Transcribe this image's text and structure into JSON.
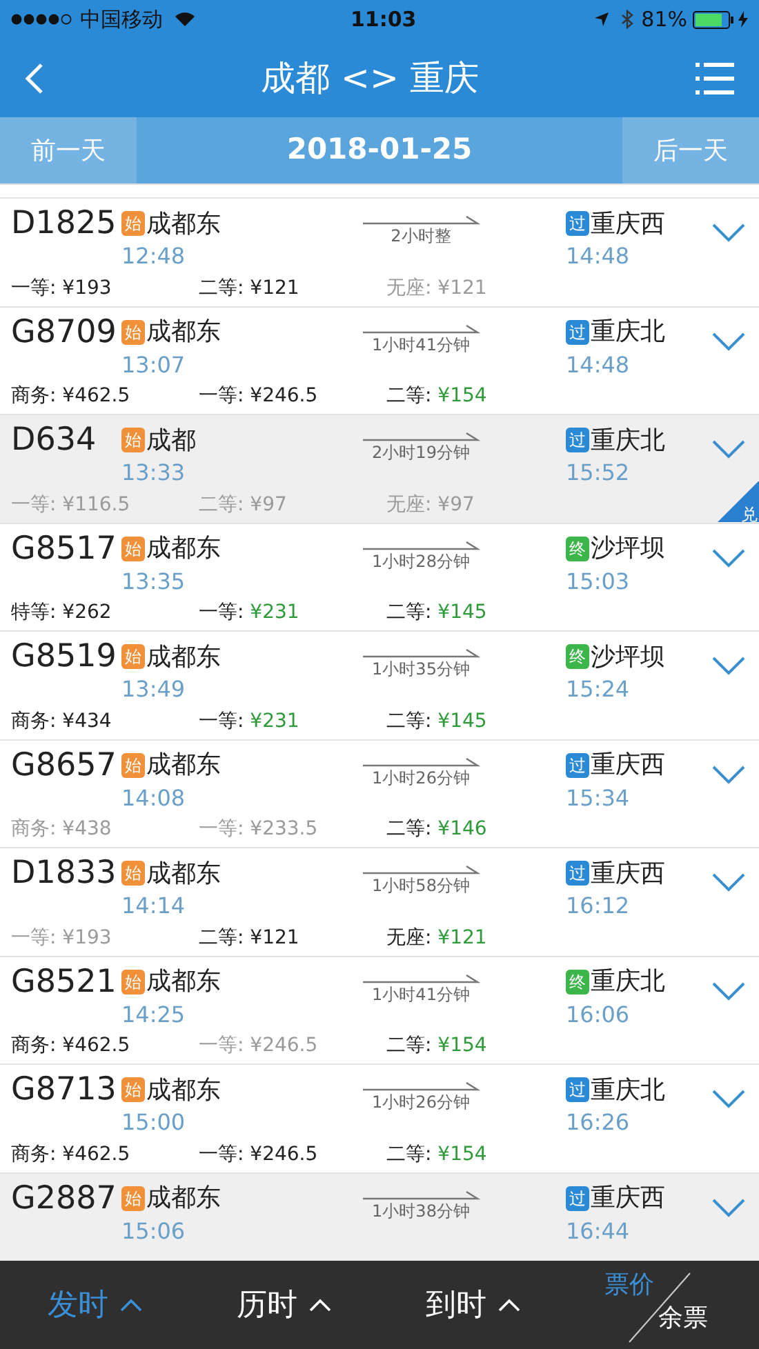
{
  "status_bar": {
    "carrier": "中国移动",
    "time": "11:03",
    "battery": "81%"
  },
  "header": {
    "title": "成都 <> 重庆"
  },
  "date_bar": {
    "prev": "前一天",
    "date": "2018-01-25",
    "next": "后一天"
  },
  "trains": [
    {
      "number": "D1825",
      "from_badge": {
        "kind": "start",
        "text": "始"
      },
      "from": "成都东",
      "depart": "12:48",
      "duration": "2小时整",
      "to_badge": {
        "kind": "pass",
        "text": "过"
      },
      "to": "重庆西",
      "arrive": "14:48",
      "shaded": false,
      "fares": [
        {
          "label": "一等:",
          "price": "¥193",
          "kind": "limited"
        },
        {
          "label": "二等:",
          "price": "¥121",
          "kind": "limited"
        },
        {
          "label": "无座:",
          "price": "¥121",
          "kind": "none"
        }
      ]
    },
    {
      "number": "G8709",
      "from_badge": {
        "kind": "start",
        "text": "始"
      },
      "from": "成都东",
      "depart": "13:07",
      "duration": "1小时41分钟",
      "to_badge": {
        "kind": "pass",
        "text": "过"
      },
      "to": "重庆北",
      "arrive": "14:48",
      "shaded": false,
      "fares": [
        {
          "label": "商务:",
          "price": "¥462.5",
          "kind": "limited"
        },
        {
          "label": "一等:",
          "price": "¥246.5",
          "kind": "limited"
        },
        {
          "label": "二等:",
          "price": "¥154",
          "kind": "plenty"
        }
      ]
    },
    {
      "number": "D634",
      "from_badge": {
        "kind": "start",
        "text": "始"
      },
      "from": "成都",
      "depart": "13:33",
      "duration": "2小时19分钟",
      "to_badge": {
        "kind": "pass",
        "text": "过"
      },
      "to": "重庆北",
      "arrive": "15:52",
      "shaded": true,
      "corner_badge": "兑",
      "fares": [
        {
          "label": "一等:",
          "price": "¥116.5",
          "kind": "none"
        },
        {
          "label": "二等:",
          "price": "¥97",
          "kind": "none"
        },
        {
          "label": "无座:",
          "price": "¥97",
          "kind": "none"
        }
      ]
    },
    {
      "number": "G8517",
      "from_badge": {
        "kind": "start",
        "text": "始"
      },
      "from": "成都东",
      "depart": "13:35",
      "duration": "1小时28分钟",
      "to_badge": {
        "kind": "end",
        "text": "终"
      },
      "to": "沙坪坝",
      "arrive": "15:03",
      "shaded": false,
      "fares": [
        {
          "label": "特等:",
          "price": "¥262",
          "kind": "limited"
        },
        {
          "label": "一等:",
          "price": "¥231",
          "kind": "plenty"
        },
        {
          "label": "二等:",
          "price": "¥145",
          "kind": "plenty"
        }
      ]
    },
    {
      "number": "G8519",
      "from_badge": {
        "kind": "start",
        "text": "始"
      },
      "from": "成都东",
      "depart": "13:49",
      "duration": "1小时35分钟",
      "to_badge": {
        "kind": "end",
        "text": "终"
      },
      "to": "沙坪坝",
      "arrive": "15:24",
      "shaded": false,
      "fares": [
        {
          "label": "商务:",
          "price": "¥434",
          "kind": "limited"
        },
        {
          "label": "一等:",
          "price": "¥231",
          "kind": "plenty"
        },
        {
          "label": "二等:",
          "price": "¥145",
          "kind": "plenty"
        }
      ]
    },
    {
      "number": "G8657",
      "from_badge": {
        "kind": "start",
        "text": "始"
      },
      "from": "成都东",
      "depart": "14:08",
      "duration": "1小时26分钟",
      "to_badge": {
        "kind": "pass",
        "text": "过"
      },
      "to": "重庆西",
      "arrive": "15:34",
      "shaded": false,
      "fares": [
        {
          "label": "商务:",
          "price": "¥438",
          "kind": "none"
        },
        {
          "label": "一等:",
          "price": "¥233.5",
          "kind": "none"
        },
        {
          "label": "二等:",
          "price": "¥146",
          "kind": "plenty"
        }
      ]
    },
    {
      "number": "D1833",
      "from_badge": {
        "kind": "start",
        "text": "始"
      },
      "from": "成都东",
      "depart": "14:14",
      "duration": "1小时58分钟",
      "to_badge": {
        "kind": "pass",
        "text": "过"
      },
      "to": "重庆西",
      "arrive": "16:12",
      "shaded": false,
      "fares": [
        {
          "label": "一等:",
          "price": "¥193",
          "kind": "none"
        },
        {
          "label": "二等:",
          "price": "¥121",
          "kind": "limited"
        },
        {
          "label": "无座:",
          "price": "¥121",
          "kind": "plenty"
        }
      ]
    },
    {
      "number": "G8521",
      "from_badge": {
        "kind": "start",
        "text": "始"
      },
      "from": "成都东",
      "depart": "14:25",
      "duration": "1小时41分钟",
      "to_badge": {
        "kind": "end",
        "text": "终"
      },
      "to": "重庆北",
      "arrive": "16:06",
      "shaded": false,
      "fares": [
        {
          "label": "商务:",
          "price": "¥462.5",
          "kind": "limited"
        },
        {
          "label": "一等:",
          "price": "¥246.5",
          "kind": "none"
        },
        {
          "label": "二等:",
          "price": "¥154",
          "kind": "plenty"
        }
      ]
    },
    {
      "number": "G8713",
      "from_badge": {
        "kind": "start",
        "text": "始"
      },
      "from": "成都东",
      "depart": "15:00",
      "duration": "1小时26分钟",
      "to_badge": {
        "kind": "pass",
        "text": "过"
      },
      "to": "重庆北",
      "arrive": "16:26",
      "shaded": false,
      "fares": [
        {
          "label": "商务:",
          "price": "¥462.5",
          "kind": "limited"
        },
        {
          "label": "一等:",
          "price": "¥246.5",
          "kind": "limited"
        },
        {
          "label": "二等:",
          "price": "¥154",
          "kind": "plenty"
        }
      ]
    },
    {
      "number": "G2887",
      "from_badge": {
        "kind": "start",
        "text": "始"
      },
      "from": "成都东",
      "depart": "15:06",
      "duration": "1小时38分钟",
      "to_badge": {
        "kind": "pass",
        "text": "过"
      },
      "to": "重庆西",
      "arrive": "16:44",
      "shaded": true
    }
  ],
  "sort_bar": {
    "tabs": [
      {
        "label": "发时",
        "selected": true
      },
      {
        "label": "历时",
        "selected": false
      },
      {
        "label": "到时",
        "selected": false
      }
    ],
    "toggle": [
      {
        "label": "票价",
        "selected": true
      },
      {
        "label": "余票",
        "selected": false
      }
    ]
  }
}
